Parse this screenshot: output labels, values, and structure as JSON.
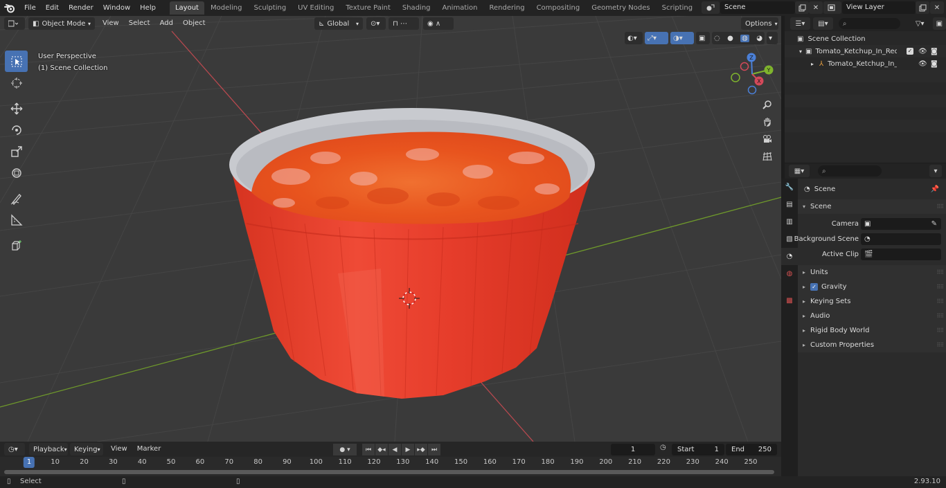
{
  "menu": {
    "items": [
      "File",
      "Edit",
      "Render",
      "Window",
      "Help"
    ]
  },
  "workspaces": {
    "tabs": [
      "Layout",
      "Modeling",
      "Sculpting",
      "UV Editing",
      "Texture Paint",
      "Shading",
      "Animation",
      "Rendering",
      "Compositing",
      "Geometry Nodes",
      "Scripting"
    ],
    "active": "Layout",
    "add_symbol": "+"
  },
  "scene_selector": {
    "value": "Scene"
  },
  "view_layer_selector": {
    "value": "View Layer"
  },
  "viewport": {
    "mode": "Object Mode",
    "menus": [
      "View",
      "Select",
      "Add",
      "Object"
    ],
    "transform_orientation": "Global",
    "options_label": "Options",
    "perspective_label": "User Perspective",
    "collection_label": "(1) Scene Collection",
    "gizmo_axes": {
      "x": "X",
      "y": "Y",
      "z": "Z"
    },
    "colors": {
      "background": "#3a3a3a",
      "grid": "#474747",
      "x_axis": "#b8494f",
      "y_axis": "#6f9a2b",
      "object_red": "#e83a2a",
      "object_rim": "#c8cacf",
      "sauce": "#e85a22"
    }
  },
  "outliner": {
    "root": "Scene Collection",
    "items": [
      {
        "name": "Tomato_Ketchup_In_Red_Grav",
        "level": 1,
        "checked": true
      },
      {
        "name": "Tomato_Ketchup_In_Red_",
        "level": 2,
        "checked": false
      }
    ]
  },
  "properties": {
    "context": "Scene",
    "section": "Scene",
    "fields": [
      {
        "label": "Camera",
        "value": ""
      },
      {
        "label": "Background Scene",
        "value": ""
      },
      {
        "label": "Active Clip",
        "value": ""
      }
    ],
    "panels": [
      "Units",
      "Gravity",
      "Keying Sets",
      "Audio",
      "Rigid Body World",
      "Custom Properties"
    ],
    "gravity_checked": true
  },
  "timeline": {
    "menus": [
      "Playback",
      "Keying",
      "View",
      "Marker"
    ],
    "current_frame": "1",
    "start_label": "Start",
    "start": "1",
    "end_label": "End",
    "end": "250",
    "ruler": [
      "1",
      "10",
      "20",
      "30",
      "40",
      "50",
      "60",
      "70",
      "80",
      "90",
      "100",
      "110",
      "120",
      "130",
      "140",
      "150",
      "160",
      "170",
      "180",
      "190",
      "200",
      "210",
      "220",
      "230",
      "240",
      "250"
    ],
    "active_color": "#4772b3"
  },
  "statusbar": {
    "action": "Select",
    "version": "2.93.10"
  }
}
